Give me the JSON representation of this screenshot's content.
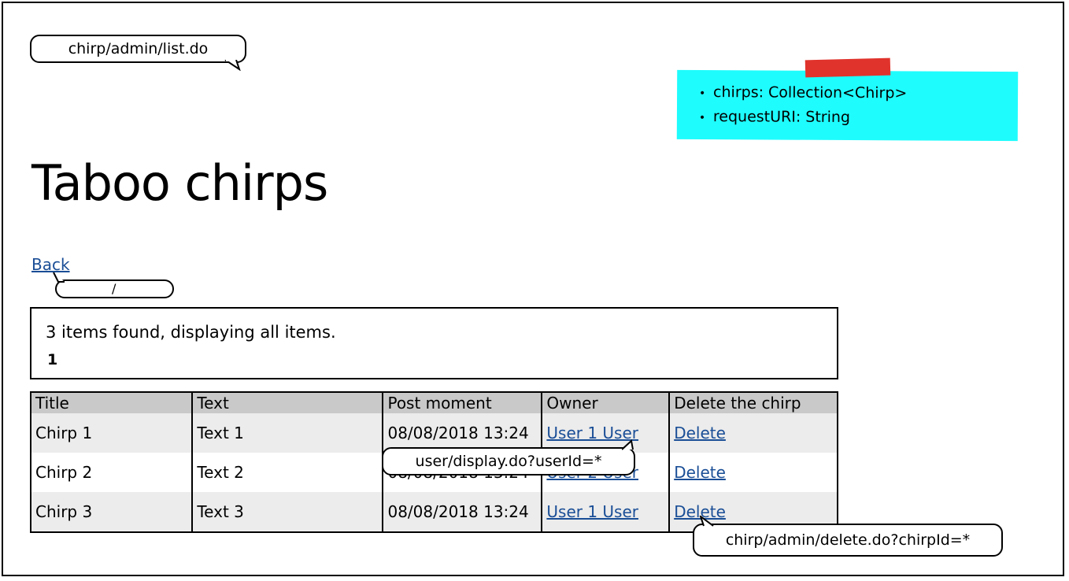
{
  "url_bubble": "chirp/admin/list.do",
  "note": {
    "items": [
      "chirps: Collection<Chirp>",
      "requestURI: String"
    ]
  },
  "page_title": "Taboo chirps",
  "back_link": "Back",
  "back_bubble_sep": "/",
  "info": {
    "message": "3 items found, displaying all items.",
    "page": "1"
  },
  "table": {
    "headers": [
      "Title",
      "Text",
      "Post moment",
      "Owner",
      "Delete the chirp"
    ],
    "rows": [
      {
        "title": "Chirp 1",
        "text": "Text 1",
        "moment": "08/08/2018 13:24",
        "owner": "User 1 User",
        "delete": "Delete"
      },
      {
        "title": "Chirp 2",
        "text": "Text 2",
        "moment": "08/08/2018 13:24",
        "owner": "User 2 User",
        "delete": "Delete"
      },
      {
        "title": "Chirp 3",
        "text": "Text 3",
        "moment": "08/08/2018 13:24",
        "owner": "User 1 User",
        "delete": "Delete"
      }
    ]
  },
  "owner_bubble": "user/display.do?userId=*",
  "delete_bubble": "chirp/admin/delete.do?chirpId=*",
  "colors": {
    "note": "#1ffcfd",
    "tape": "#e0332c",
    "link": "#1a4e96",
    "header": "#c9c9c9",
    "stripe": "#ececec"
  }
}
